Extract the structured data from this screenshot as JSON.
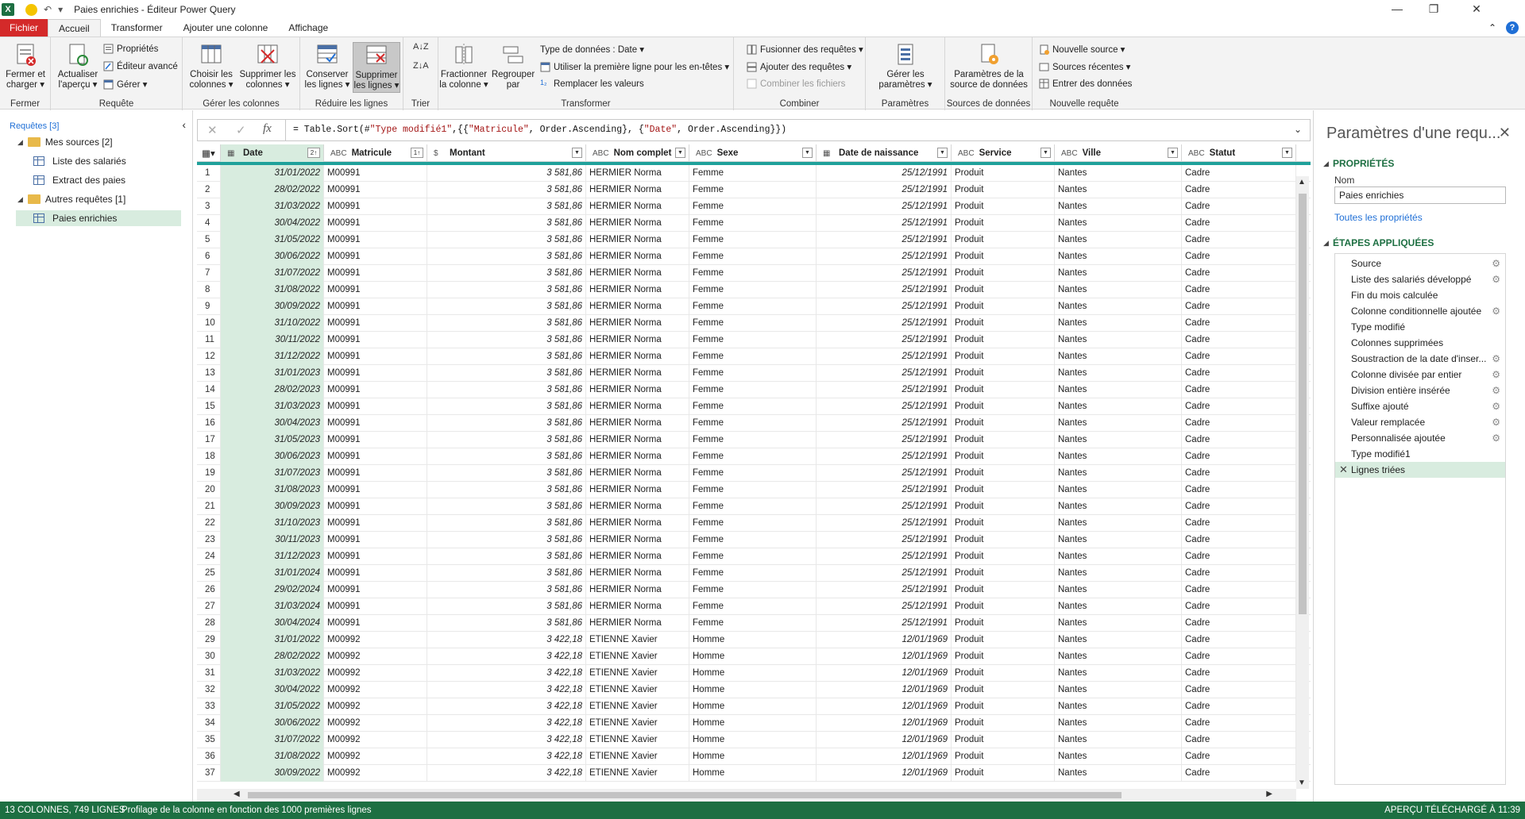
{
  "window": {
    "title": "Paies enrichies - Éditeur Power Query",
    "app_icon": "X",
    "minimize": "—",
    "restore": "❐",
    "close": "✕"
  },
  "colors": {
    "excel_green": "#1d6f42",
    "file_red": "#d42a2a",
    "selected_green": "#d8ecdf",
    "quality_bar": "#1fa19b",
    "link_blue": "#1f6fd6"
  },
  "tabs": [
    {
      "label": "Fichier",
      "active": false
    },
    {
      "label": "Accueil",
      "active": true
    },
    {
      "label": "Transformer",
      "active": false
    },
    {
      "label": "Ajouter une colonne",
      "active": false
    },
    {
      "label": "Affichage",
      "active": false
    }
  ],
  "ribbon": {
    "groups": {
      "fermer": "Fermer",
      "requete": "Requête",
      "gerer_colonnes": "Gérer les colonnes",
      "reduire_lignes": "Réduire les lignes",
      "trier": "Trier",
      "transformer": "Transformer",
      "combiner": "Combiner",
      "parametres": "Paramètres",
      "sources": "Sources de données",
      "nouvelle": "Nouvelle requête"
    },
    "buttons": {
      "fermer_l1": "Fermer et",
      "fermer_l2": "charger ▾",
      "actualiser_l1": "Actualiser",
      "actualiser_l2": "l'aperçu ▾",
      "proprietes": "Propriétés",
      "editeur": "Éditeur avancé",
      "gerer": "Gérer ▾",
      "choisir_l1": "Choisir les",
      "choisir_l2": "colonnes ▾",
      "supprimer_col_l1": "Supprimer les",
      "supprimer_col_l2": "colonnes ▾",
      "conserver_l1": "Conserver",
      "conserver_l2": "les lignes ▾",
      "supprimer_lig_l1": "Supprimer",
      "supprimer_lig_l2": "les lignes ▾",
      "fractionner_l1": "Fractionner",
      "fractionner_l2": "la colonne ▾",
      "regrouper_l1": "Regrouper",
      "regrouper_l2": "par",
      "type_donnees": "Type de données : Date ▾",
      "premiere_ligne": "Utiliser la première ligne pour les en-têtes ▾",
      "remplacer": "Remplacer les valeurs",
      "fusionner": "Fusionner des requêtes ▾",
      "ajouter": "Ajouter des requêtes ▾",
      "combiner_fichiers": "Combiner les fichiers",
      "gerer_param_l1": "Gérer les",
      "gerer_param_l2": "paramètres ▾",
      "param_source_l1": "Paramètres de la",
      "param_source_l2": "source de données",
      "nouvelle_source": "Nouvelle source ▾",
      "sources_recentes": "Sources récentes ▾",
      "entrer_donnees": "Entrer des données"
    }
  },
  "left_pane": {
    "header": "Requêtes [3]",
    "collapse": "‹",
    "items": [
      {
        "label": "Mes sources [2]",
        "type": "folder",
        "level": 0
      },
      {
        "label": "Liste des salariés",
        "type": "table",
        "level": 1
      },
      {
        "label": "Extract des paies",
        "type": "table",
        "level": 1
      },
      {
        "label": "Autres requêtes [1]",
        "type": "folder",
        "level": 0
      },
      {
        "label": "Paies enrichies",
        "type": "table",
        "level": 1,
        "selected": true
      }
    ]
  },
  "formula": {
    "cancel": "✕",
    "commit": "✓",
    "fx": "fx",
    "p1": "= Table.Sort(#",
    "s1": "\"Type modifié1\"",
    "p2": ",{{",
    "s2": "\"Matricule\"",
    "p3": ", Order.Ascending}, {",
    "s3": "\"Date\"",
    "p4": ", Order.Ascending}})",
    "expand": "⌄"
  },
  "grid": {
    "columns": [
      {
        "name": "Date",
        "type_icon": "▦",
        "sort": "2↑",
        "selected": true
      },
      {
        "name": "Matricule",
        "type_icon": "ABC",
        "sort": "1↑"
      },
      {
        "name": "Montant",
        "type_icon": "$"
      },
      {
        "name": "Nom complet",
        "type_icon": "ABC"
      },
      {
        "name": "Sexe",
        "type_icon": "ABC"
      },
      {
        "name": "Date de naissance",
        "type_icon": "▦"
      },
      {
        "name": "Service",
        "type_icon": "ABC"
      },
      {
        "name": "Ville",
        "type_icon": "ABC"
      },
      {
        "name": "Statut",
        "type_icon": "ABC"
      }
    ],
    "rows": [
      [
        "31/01/2022",
        "M00991",
        "3 581,86",
        "HERMIER Norma",
        "Femme",
        "25/12/1991",
        "Produit",
        "Nantes",
        "Cadre"
      ],
      [
        "28/02/2022",
        "M00991",
        "3 581,86",
        "HERMIER Norma",
        "Femme",
        "25/12/1991",
        "Produit",
        "Nantes",
        "Cadre"
      ],
      [
        "31/03/2022",
        "M00991",
        "3 581,86",
        "HERMIER Norma",
        "Femme",
        "25/12/1991",
        "Produit",
        "Nantes",
        "Cadre"
      ],
      [
        "30/04/2022",
        "M00991",
        "3 581,86",
        "HERMIER Norma",
        "Femme",
        "25/12/1991",
        "Produit",
        "Nantes",
        "Cadre"
      ],
      [
        "31/05/2022",
        "M00991",
        "3 581,86",
        "HERMIER Norma",
        "Femme",
        "25/12/1991",
        "Produit",
        "Nantes",
        "Cadre"
      ],
      [
        "30/06/2022",
        "M00991",
        "3 581,86",
        "HERMIER Norma",
        "Femme",
        "25/12/1991",
        "Produit",
        "Nantes",
        "Cadre"
      ],
      [
        "31/07/2022",
        "M00991",
        "3 581,86",
        "HERMIER Norma",
        "Femme",
        "25/12/1991",
        "Produit",
        "Nantes",
        "Cadre"
      ],
      [
        "31/08/2022",
        "M00991",
        "3 581,86",
        "HERMIER Norma",
        "Femme",
        "25/12/1991",
        "Produit",
        "Nantes",
        "Cadre"
      ],
      [
        "30/09/2022",
        "M00991",
        "3 581,86",
        "HERMIER Norma",
        "Femme",
        "25/12/1991",
        "Produit",
        "Nantes",
        "Cadre"
      ],
      [
        "31/10/2022",
        "M00991",
        "3 581,86",
        "HERMIER Norma",
        "Femme",
        "25/12/1991",
        "Produit",
        "Nantes",
        "Cadre"
      ],
      [
        "30/11/2022",
        "M00991",
        "3 581,86",
        "HERMIER Norma",
        "Femme",
        "25/12/1991",
        "Produit",
        "Nantes",
        "Cadre"
      ],
      [
        "31/12/2022",
        "M00991",
        "3 581,86",
        "HERMIER Norma",
        "Femme",
        "25/12/1991",
        "Produit",
        "Nantes",
        "Cadre"
      ],
      [
        "31/01/2023",
        "M00991",
        "3 581,86",
        "HERMIER Norma",
        "Femme",
        "25/12/1991",
        "Produit",
        "Nantes",
        "Cadre"
      ],
      [
        "28/02/2023",
        "M00991",
        "3 581,86",
        "HERMIER Norma",
        "Femme",
        "25/12/1991",
        "Produit",
        "Nantes",
        "Cadre"
      ],
      [
        "31/03/2023",
        "M00991",
        "3 581,86",
        "HERMIER Norma",
        "Femme",
        "25/12/1991",
        "Produit",
        "Nantes",
        "Cadre"
      ],
      [
        "30/04/2023",
        "M00991",
        "3 581,86",
        "HERMIER Norma",
        "Femme",
        "25/12/1991",
        "Produit",
        "Nantes",
        "Cadre"
      ],
      [
        "31/05/2023",
        "M00991",
        "3 581,86",
        "HERMIER Norma",
        "Femme",
        "25/12/1991",
        "Produit",
        "Nantes",
        "Cadre"
      ],
      [
        "30/06/2023",
        "M00991",
        "3 581,86",
        "HERMIER Norma",
        "Femme",
        "25/12/1991",
        "Produit",
        "Nantes",
        "Cadre"
      ],
      [
        "31/07/2023",
        "M00991",
        "3 581,86",
        "HERMIER Norma",
        "Femme",
        "25/12/1991",
        "Produit",
        "Nantes",
        "Cadre"
      ],
      [
        "31/08/2023",
        "M00991",
        "3 581,86",
        "HERMIER Norma",
        "Femme",
        "25/12/1991",
        "Produit",
        "Nantes",
        "Cadre"
      ],
      [
        "30/09/2023",
        "M00991",
        "3 581,86",
        "HERMIER Norma",
        "Femme",
        "25/12/1991",
        "Produit",
        "Nantes",
        "Cadre"
      ],
      [
        "31/10/2023",
        "M00991",
        "3 581,86",
        "HERMIER Norma",
        "Femme",
        "25/12/1991",
        "Produit",
        "Nantes",
        "Cadre"
      ],
      [
        "30/11/2023",
        "M00991",
        "3 581,86",
        "HERMIER Norma",
        "Femme",
        "25/12/1991",
        "Produit",
        "Nantes",
        "Cadre"
      ],
      [
        "31/12/2023",
        "M00991",
        "3 581,86",
        "HERMIER Norma",
        "Femme",
        "25/12/1991",
        "Produit",
        "Nantes",
        "Cadre"
      ],
      [
        "31/01/2024",
        "M00991",
        "3 581,86",
        "HERMIER Norma",
        "Femme",
        "25/12/1991",
        "Produit",
        "Nantes",
        "Cadre"
      ],
      [
        "29/02/2024",
        "M00991",
        "3 581,86",
        "HERMIER Norma",
        "Femme",
        "25/12/1991",
        "Produit",
        "Nantes",
        "Cadre"
      ],
      [
        "31/03/2024",
        "M00991",
        "3 581,86",
        "HERMIER Norma",
        "Femme",
        "25/12/1991",
        "Produit",
        "Nantes",
        "Cadre"
      ],
      [
        "30/04/2024",
        "M00991",
        "3 581,86",
        "HERMIER Norma",
        "Femme",
        "25/12/1991",
        "Produit",
        "Nantes",
        "Cadre"
      ],
      [
        "31/01/2022",
        "M00992",
        "3 422,18",
        "ETIENNE Xavier",
        "Homme",
        "12/01/1969",
        "Produit",
        "Nantes",
        "Cadre"
      ],
      [
        "28/02/2022",
        "M00992",
        "3 422,18",
        "ETIENNE Xavier",
        "Homme",
        "12/01/1969",
        "Produit",
        "Nantes",
        "Cadre"
      ],
      [
        "31/03/2022",
        "M00992",
        "3 422,18",
        "ETIENNE Xavier",
        "Homme",
        "12/01/1969",
        "Produit",
        "Nantes",
        "Cadre"
      ],
      [
        "30/04/2022",
        "M00992",
        "3 422,18",
        "ETIENNE Xavier",
        "Homme",
        "12/01/1969",
        "Produit",
        "Nantes",
        "Cadre"
      ],
      [
        "31/05/2022",
        "M00992",
        "3 422,18",
        "ETIENNE Xavier",
        "Homme",
        "12/01/1969",
        "Produit",
        "Nantes",
        "Cadre"
      ],
      [
        "30/06/2022",
        "M00992",
        "3 422,18",
        "ETIENNE Xavier",
        "Homme",
        "12/01/1969",
        "Produit",
        "Nantes",
        "Cadre"
      ],
      [
        "31/07/2022",
        "M00992",
        "3 422,18",
        "ETIENNE Xavier",
        "Homme",
        "12/01/1969",
        "Produit",
        "Nantes",
        "Cadre"
      ],
      [
        "31/08/2022",
        "M00992",
        "3 422,18",
        "ETIENNE Xavier",
        "Homme",
        "12/01/1969",
        "Produit",
        "Nantes",
        "Cadre"
      ],
      [
        "30/09/2022",
        "M00992",
        "3 422,18",
        "ETIENNE Xavier",
        "Homme",
        "12/01/1969",
        "Produit",
        "Nantes",
        "Cadre"
      ]
    ]
  },
  "right_pane": {
    "title": "Paramètres d'une requ...",
    "close": "✕",
    "properties_header": "PROPRIÉTÉS",
    "name_label": "Nom",
    "name_value": "Paies enrichies",
    "all_props_link": "Toutes les propriétés",
    "steps_header": "ÉTAPES APPLIQUÉES",
    "steps": [
      {
        "label": "Source",
        "gear": true
      },
      {
        "label": "Liste des salariés développé",
        "gear": true
      },
      {
        "label": "Fin du mois calculée",
        "gear": false
      },
      {
        "label": "Colonne conditionnelle ajoutée",
        "gear": true
      },
      {
        "label": "Type modifié",
        "gear": false
      },
      {
        "label": "Colonnes supprimées",
        "gear": false
      },
      {
        "label": "Soustraction de la date d'inser...",
        "gear": true
      },
      {
        "label": "Colonne divisée par entier",
        "gear": true
      },
      {
        "label": "Division entière insérée",
        "gear": true
      },
      {
        "label": "Suffixe ajouté",
        "gear": true
      },
      {
        "label": "Valeur remplacée",
        "gear": true
      },
      {
        "label": "Personnalisée ajoutée",
        "gear": true
      },
      {
        "label": "Type modifié1",
        "gear": false
      },
      {
        "label": "Lignes triées",
        "gear": false,
        "selected": true
      }
    ]
  },
  "status": {
    "left": "13 COLONNES, 749 LIGNES",
    "middle": "Profilage de la colonne en fonction des 1000 premières lignes",
    "right": "APERÇU TÉLÉCHARGÉ À 11:39"
  }
}
